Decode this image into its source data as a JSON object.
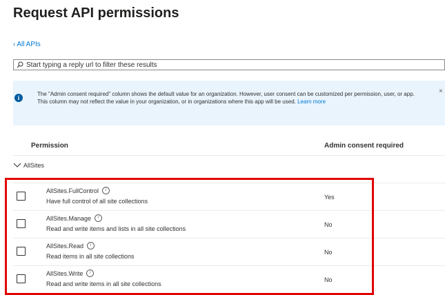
{
  "page_title": "Request API permissions",
  "back_link": "All APIs",
  "search": {
    "placeholder": "Start typing a reply url to filter these results"
  },
  "info": {
    "text": "The \"Admin consent required\" column shows the default value for an organization. However, user consent can be customized per permission, user, or app. This column may not reflect the value in your organization, or in organizations where this app will be used.",
    "learn_more": "Learn more",
    "close_glyph": "×"
  },
  "table": {
    "headers": {
      "permission": "Permission",
      "admin": "Admin consent required"
    },
    "group": {
      "name": "AllSites",
      "expanded": true
    },
    "rows": [
      {
        "name": "AllSites.FullControl",
        "description": "Have full control of all site collections",
        "admin_consent": "Yes",
        "checked": false
      },
      {
        "name": "AllSites.Manage",
        "description": "Read and write items and lists in all site collections",
        "admin_consent": "No",
        "checked": false
      },
      {
        "name": "AllSites.Read",
        "description": "Read items in all site collections",
        "admin_consent": "No",
        "checked": false
      },
      {
        "name": "AllSites.Write",
        "description": "Read and write items in all site collections",
        "admin_consent": "No",
        "checked": false
      }
    ]
  },
  "icons": {
    "back": "chevron-left-icon",
    "search": "search-icon",
    "info": "info-icon",
    "close": "close-icon",
    "group": "chevron-down-icon",
    "help": "info-circle-icon"
  },
  "colors": {
    "accent": "#0078d4",
    "info_bg": "#e9f4fd",
    "highlight": "#e00000"
  }
}
